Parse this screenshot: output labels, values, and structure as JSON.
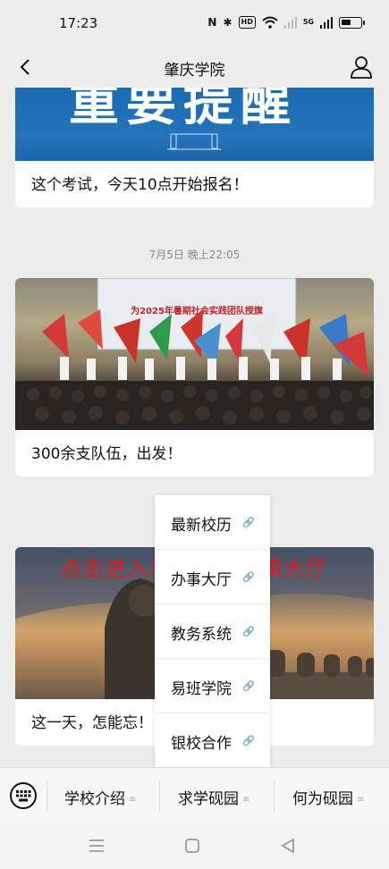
{
  "status": {
    "time": "17:23",
    "hd_label": "HD",
    "net_label": "5G"
  },
  "nav": {
    "title": "肇庆学院"
  },
  "card1": {
    "banner_text": "重要提醒",
    "caption": "这个考试，今天10点开始报名！"
  },
  "timestamp": "7月5日 晚上22:05",
  "card2": {
    "banner_text": "为2025年暑期社会实践团队授旗",
    "caption": "300余支队伍，出发！"
  },
  "card3": {
    "caption": "这一天，怎能忘！"
  },
  "annotation": "点击进入肇庆学院办事大厅",
  "popup": {
    "items": [
      {
        "label": "最新校历"
      },
      {
        "label": "办事大厅"
      },
      {
        "label": "教务系统"
      },
      {
        "label": "易班学院"
      },
      {
        "label": "银校合作"
      }
    ]
  },
  "menu": {
    "tabs": [
      {
        "label": "学校介绍"
      },
      {
        "label": "求学砚园"
      },
      {
        "label": "何为砚园"
      }
    ]
  },
  "colors": {
    "annotation": "#e31b1b",
    "banner_blue": "#1a6ab0"
  }
}
